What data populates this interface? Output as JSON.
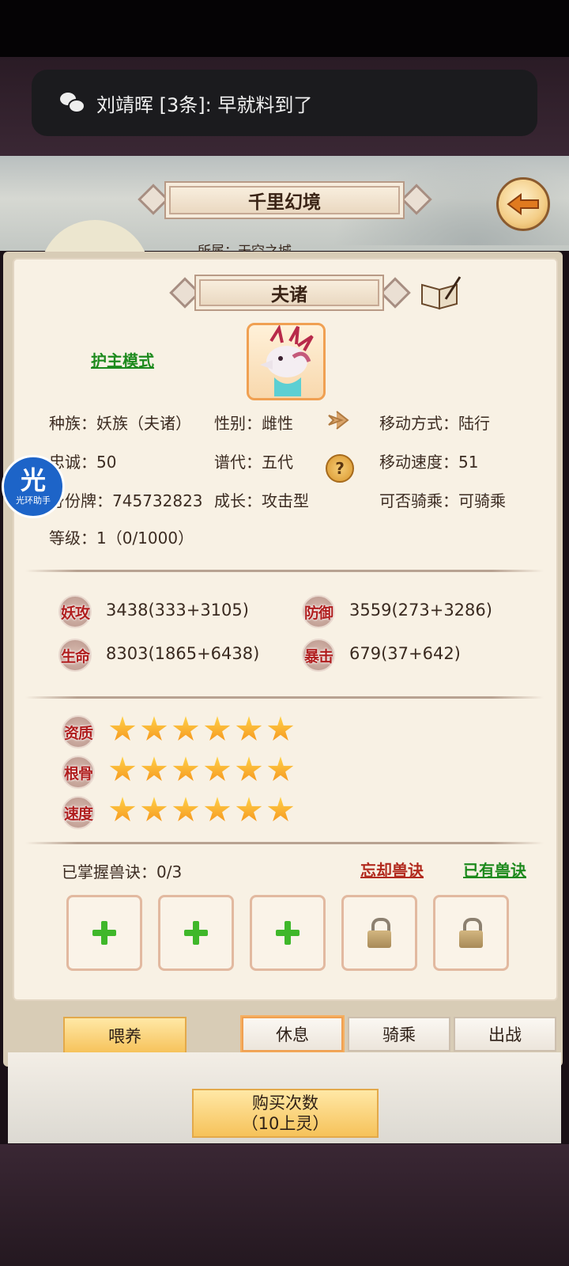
{
  "notification": {
    "text": "刘靖晖  [3条]: 早就料到了"
  },
  "header": {
    "title": "千里幻境",
    "back_icon": "back-arrow-icon"
  },
  "scenery_text": "所属：天空之城",
  "pet": {
    "name": "夫诸",
    "mode_link": "护主模式",
    "info_rows": [
      [
        "种族：妖族（夫诸）",
        "性别：雌性",
        "移动方式：陆行"
      ],
      [
        "忠诚：50",
        "谱代：五代",
        "移动速度：51"
      ],
      [
        "身份牌：745732823",
        "成长：攻击型",
        "可否骑乘：可骑乘"
      ],
      [
        "等级：1（0/1000）",
        "",
        ""
      ]
    ]
  },
  "stats": [
    {
      "label": "妖攻",
      "value": "3438(333+3105)"
    },
    {
      "label": "防御",
      "value": "3559(273+3286)"
    },
    {
      "label": "生命",
      "value": "8303(1865+6438)"
    },
    {
      "label": "暴击",
      "value": "679(37+642)"
    }
  ],
  "ratings": [
    {
      "label": "资质",
      "stars": 6
    },
    {
      "label": "根骨",
      "stars": 6
    },
    {
      "label": "速度",
      "stars": 6
    }
  ],
  "skills": {
    "mastered": "已掌握兽诀：0/3",
    "forget_link": "忘却兽诀",
    "owned_link": "已有兽诀",
    "slots": [
      "add",
      "add",
      "add",
      "locked",
      "locked"
    ]
  },
  "actions": {
    "feed": "喂养",
    "rest": "休息",
    "ride": "骑乘",
    "battle": "出战"
  },
  "buy": {
    "line1": "购买次数",
    "line2": "（10上灵）"
  },
  "overlay": {
    "char": "光",
    "label": "光环助手"
  }
}
